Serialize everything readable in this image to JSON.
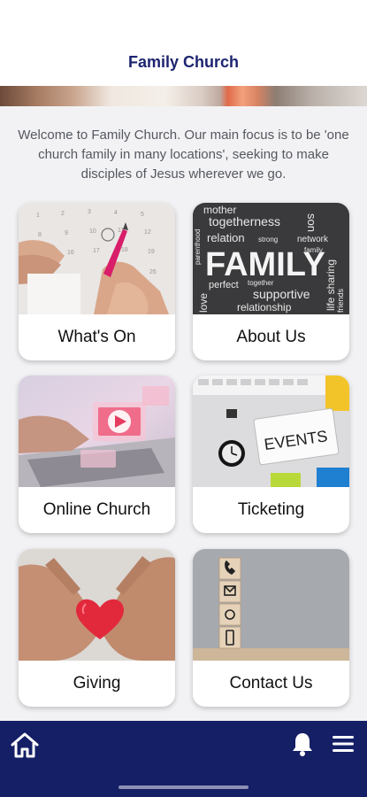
{
  "header": {
    "title": "Family Church"
  },
  "intro": {
    "text": "Welcome to Family Church. Our main focus is to be 'one church family in many locations', seeking to make disciples of Jesus wherever we go."
  },
  "cards": [
    {
      "label": "What's On",
      "image": "calendar-photo"
    },
    {
      "label": "About Us",
      "image": "family-word-cloud",
      "image_words": [
        "mother",
        "togetherness",
        "relation",
        "FAMILY",
        "perfect",
        "together",
        "supportive",
        "relationship",
        "love",
        "parenthood",
        "strong",
        "network",
        "life sharing",
        "son",
        "family",
        "friends"
      ]
    },
    {
      "label": "Online Church",
      "image": "laptop-video-photo"
    },
    {
      "label": "Ticketing",
      "image": "events-notepad-photo",
      "image_words": [
        "EVENTS"
      ]
    },
    {
      "label": "Giving",
      "image": "hands-heart-photo"
    },
    {
      "label": "Contact Us",
      "image": "contact-blocks-photo"
    }
  ],
  "nav": {
    "home_icon": "home-icon",
    "bell_icon": "bell-icon",
    "menu_icon": "menu-icon"
  },
  "colors": {
    "brand": "#1c2470",
    "navbar": "#141f66",
    "background": "#f2f2f4"
  }
}
